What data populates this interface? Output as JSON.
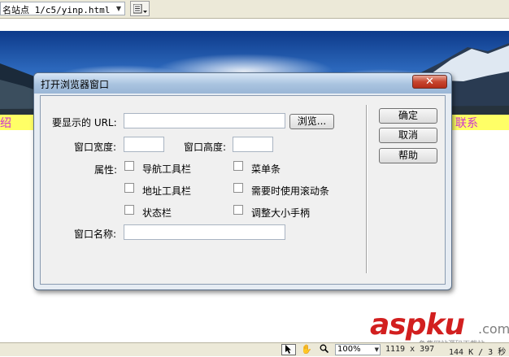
{
  "toolbar": {
    "site_path": "名站点 1/c5/yinp.html"
  },
  "page": {
    "strip_left_text": "绍",
    "strip_right_text": "联系"
  },
  "dialog": {
    "title": "打开浏览器窗口",
    "close_symbol": "✕",
    "url_label": "要显示的 URL:",
    "url_value": "",
    "browse_label": "浏览...",
    "width_label": "窗口宽度:",
    "width_value": "",
    "height_label": "窗口高度:",
    "height_value": "",
    "attributes_label": "属性:",
    "checkboxes": {
      "nav_toolbar": "导航工具栏",
      "menu_bar": "菜单条",
      "address_toolbar": "地址工具栏",
      "scrollbars": "需要时使用滚动条",
      "status_bar": "状态栏",
      "resize_handles": "调整大小手柄"
    },
    "window_name_label": "窗口名称:",
    "window_name_value": "",
    "ok_label": "确定",
    "cancel_label": "取消",
    "help_label": "帮助"
  },
  "statusbar": {
    "zoom": "100%",
    "dimensions": "1119 x 397",
    "filesize": "144 K / 3 秒"
  },
  "watermark": {
    "brand": "aspku",
    "suffix": ".com",
    "tagline": "免费网站源码下载站"
  },
  "colors": {
    "strip_background": "#ffff66",
    "strip_text": "#cc33cc",
    "close_button": "#c7452f",
    "watermark_red": "#d21f1f"
  },
  "icons": [
    "chevron-down-icon",
    "list-icon",
    "close-icon",
    "pointer-icon",
    "hand-icon",
    "zoom-icon"
  ]
}
